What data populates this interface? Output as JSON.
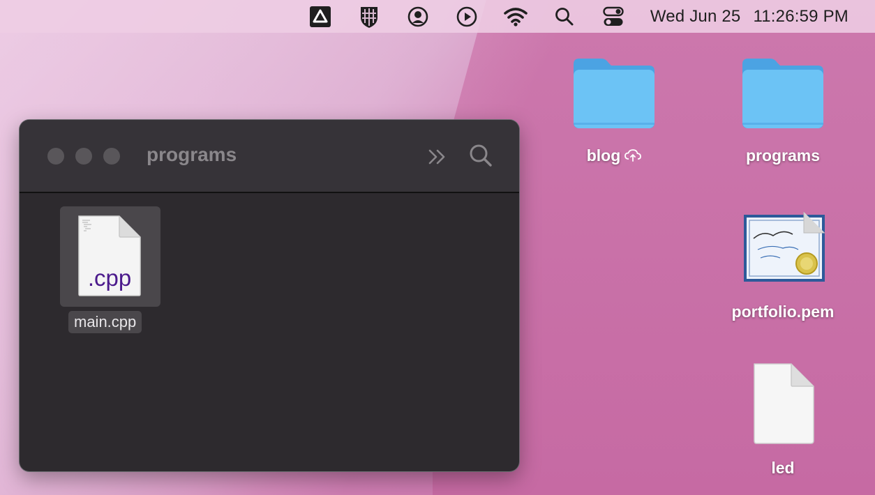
{
  "menubar": {
    "icons": [
      "drive-icon",
      "vpn-shield-icon",
      "user-icon",
      "play-icon",
      "wifi-icon",
      "search-icon",
      "control-center-icon"
    ],
    "date": "Wed Jun 25",
    "time": "11:26:59 PM"
  },
  "window": {
    "title": "programs",
    "files": [
      {
        "name": "main.cpp",
        "extension": ".cpp"
      }
    ]
  },
  "desktop": {
    "items": [
      {
        "label": "blog",
        "icon": "folder-icon",
        "badge": "icloud-upload-icon"
      },
      {
        "label": "programs",
        "icon": "folder-icon"
      },
      {
        "label": "portfolio.pem",
        "icon": "certificate-icon"
      },
      {
        "label": "led",
        "icon": "document-icon"
      }
    ]
  },
  "colors": {
    "folder": "#6cc3f5",
    "window_bg": "#2d2a2e",
    "cpp_text": "#4b1a8c"
  }
}
